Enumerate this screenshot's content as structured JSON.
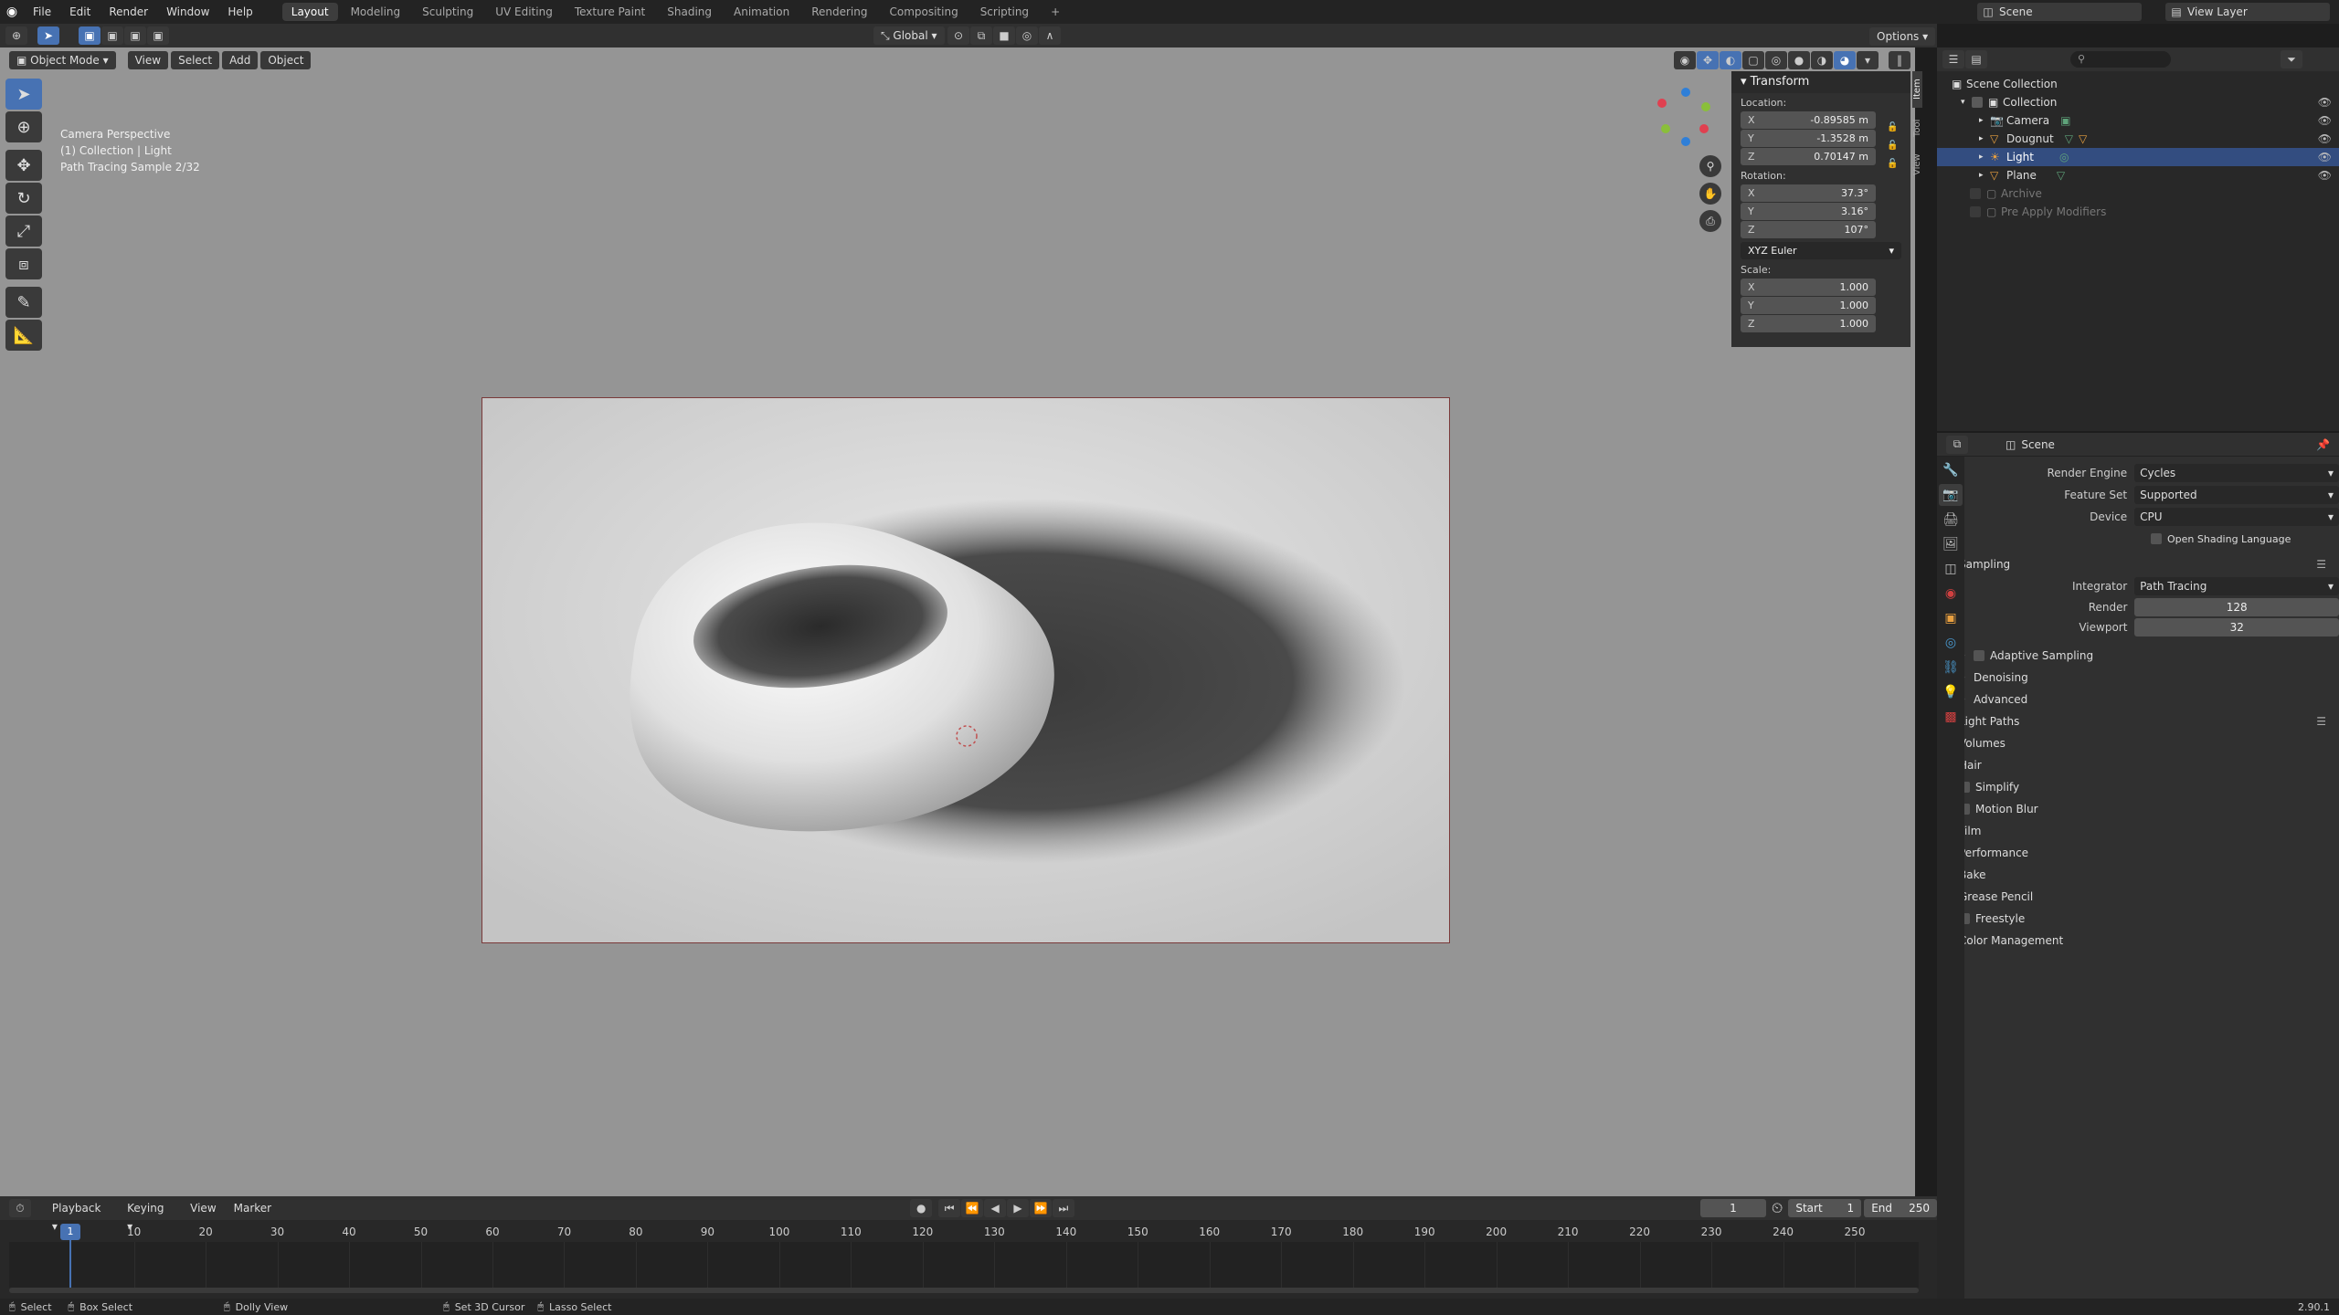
{
  "topbar": {
    "menus": [
      "File",
      "Edit",
      "Render",
      "Window",
      "Help"
    ],
    "workspaces": [
      "Layout",
      "Modeling",
      "Sculpting",
      "UV Editing",
      "Texture Paint",
      "Shading",
      "Animation",
      "Rendering",
      "Compositing",
      "Scripting"
    ],
    "active_workspace": "Layout",
    "add_tab": "+",
    "scene": "Scene",
    "view_layer": "View Layer"
  },
  "header": {
    "orientation": "Global",
    "options": "Options"
  },
  "viewport_header": {
    "mode": "Object Mode",
    "view": "View",
    "select": "Select",
    "add": "Add",
    "object": "Object"
  },
  "viewport_info": {
    "line1": "Camera Perspective",
    "line2": "(1) Collection | Light",
    "line3": "Path Tracing Sample 2/32"
  },
  "npanel": {
    "title": "Transform",
    "location_label": "Location:",
    "location": {
      "x": "-0.89585 m",
      "y": "-1.3528 m",
      "z": "0.70147 m"
    },
    "rotation_label": "Rotation:",
    "rotation": {
      "x": "37.3°",
      "y": "3.16°",
      "z": "107°"
    },
    "rotation_mode": "XYZ Euler",
    "scale_label": "Scale:",
    "scale": {
      "x": "1.000",
      "y": "1.000",
      "z": "1.000"
    },
    "axes": {
      "x": "X",
      "y": "Y",
      "z": "Z"
    },
    "tabs": [
      "Item",
      "Tool",
      "View"
    ]
  },
  "outliner": {
    "root": "Scene Collection",
    "collection": "Collection",
    "items": [
      "Camera",
      "Dougnut",
      "Light",
      "Plane"
    ],
    "selected": "Light",
    "extra": [
      "Archive",
      "Pre Apply Modifiers"
    ]
  },
  "properties": {
    "context": "Scene",
    "render_engine_label": "Render Engine",
    "render_engine": "Cycles",
    "feature_set_label": "Feature Set",
    "feature_set": "Supported",
    "device_label": "Device",
    "device": "CPU",
    "osl": "Open Shading Language",
    "sampling": "Sampling",
    "integrator_label": "Integrator",
    "integrator": "Path Tracing",
    "render_label": "Render",
    "render_samples": "128",
    "viewport_label": "Viewport",
    "viewport_samples": "32",
    "sub_sections": [
      "Adaptive Sampling",
      "Denoising",
      "Advanced"
    ],
    "sections": [
      "Light Paths",
      "Volumes",
      "Hair",
      "Simplify",
      "Motion Blur",
      "Film",
      "Performance",
      "Bake",
      "Grease Pencil",
      "Freestyle",
      "Color Management"
    ]
  },
  "timeline": {
    "playback": "Playback",
    "keying": "Keying",
    "view": "View",
    "marker": "Marker",
    "current_frame": "1",
    "start_label": "Start",
    "start": "1",
    "end_label": "End",
    "end": "250",
    "ticks": [
      "1",
      "10",
      "20",
      "30",
      "40",
      "50",
      "60",
      "70",
      "80",
      "90",
      "100",
      "110",
      "120",
      "130",
      "140",
      "150",
      "160",
      "170",
      "180",
      "190",
      "200",
      "210",
      "220",
      "230",
      "240",
      "250"
    ]
  },
  "status": {
    "select": "Select",
    "box_select": "Box Select",
    "dolly_view": "Dolly View",
    "set_3d_cursor": "Set 3D Cursor",
    "lasso_select": "Lasso Select",
    "version": "2.90.1"
  }
}
